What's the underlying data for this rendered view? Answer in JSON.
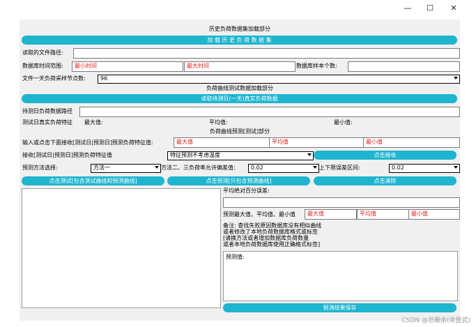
{
  "window": {
    "minimize_glyph": "—",
    "maximize_glyph": "☐",
    "close_glyph": "✕"
  },
  "section1": {
    "title": "历史负荷数据集加载部分",
    "load_button": "加 载 历 史 负 荷 数 据 集",
    "file_path_label": "读取的文件路径:",
    "file_path_value": "",
    "time_range_label": "数据库时间范围:",
    "min_time": "最小时间",
    "max_time": "最大时间",
    "sample_count_label": "数据库样本个数:",
    "sample_count_value": "",
    "daily_points_label": "文件一天负荷采样节点数:",
    "daily_points_value": "96"
  },
  "section2": {
    "title": "负荷曲线测试数据加载部分",
    "load_button": "读取待测日(一天)真实负荷数据",
    "path_label": "待测日负荷数据路径",
    "path_value": "",
    "feature_label": "测试日真实负荷特征",
    "max_label": "最大值:",
    "avg_label": "平均值:",
    "min_label": "最小值:"
  },
  "section3": {
    "title": "负荷曲线预测[测试]部分",
    "input_label": "输入或点击下面接收[测试日|预测日]预测负荷特征值:",
    "max_placeholder": "最大值",
    "avg_placeholder": "平均值",
    "min_placeholder": "最小值",
    "receive_label": "接收[测试日|预测日]预测负荷特征值",
    "receive_select": "特征预测不考虑温度",
    "receive_button": "点击接收",
    "method_label": "预测方法选择:",
    "method_value": "方法一",
    "deviation_label": "方法二、三负荷率允许偏差值:",
    "deviation_value": "0.02",
    "error_range_label": "上下限误差区间:",
    "error_range_value": "0.02",
    "test_button": "点击测试[包含测试曲线和预测曲线]",
    "predict_button": "点击预测[只包含预测曲线]",
    "clear_button": "点击清除",
    "mape_label": "平均绝对百分误差:",
    "mape_value": "",
    "pred_stats_label": "预测最大值、平均值、最小值",
    "pred_max": "最大值",
    "pred_avg": "平均值",
    "pred_min": "最小值",
    "note_lines": [
      "备注: 查找失败原因数据库没有相似曲线",
      "或者修改了本地负荷数据库格式或标签",
      "[请换方法或者增加数据库负荷数量",
      "或者本地负荷数据库使用正确格式标签]"
    ],
    "pred_value_label": "预测值:",
    "save_button": "预测结果保存"
  },
  "watermark": "CSDN @总裁余(余登武)"
}
